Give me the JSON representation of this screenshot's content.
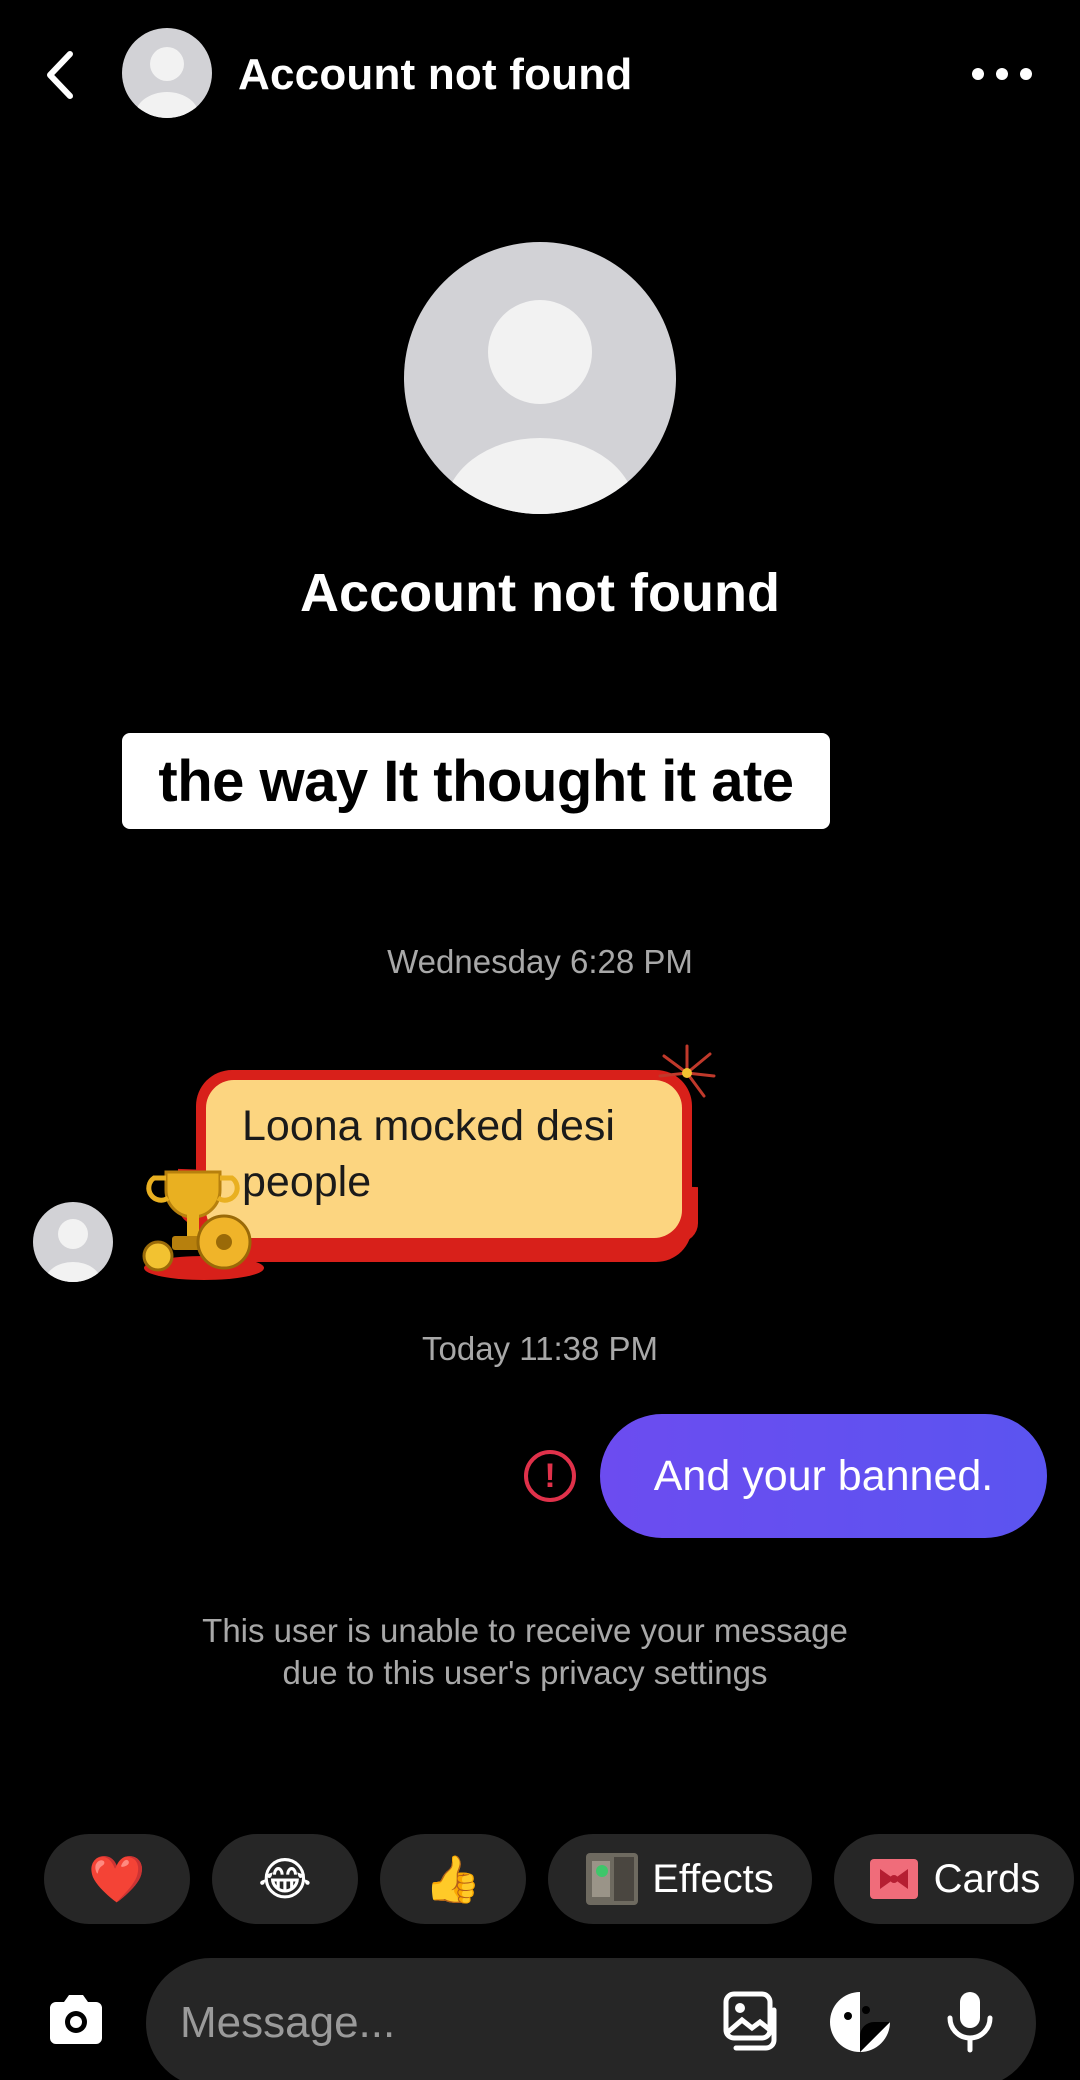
{
  "header": {
    "title": "Account not found",
    "back_icon": "chevron-left-icon",
    "more_icon": "more-horizontal-icon"
  },
  "profile": {
    "name": "Account not found"
  },
  "caption": {
    "text": "the way It thought it ate"
  },
  "thread": {
    "timestamp_1": "Wednesday 6:28 PM",
    "received_message": "Loona mocked desi people",
    "timestamp_2": "Today 11:38 PM",
    "sent_message": "And your banned.",
    "error_icon": "alert-circle-icon",
    "error_color": "#e0314a",
    "sent_bubble_color": "#5b54f0",
    "notice": "This user is unable to receive your message due to this user's privacy settings"
  },
  "quick_reactions": [
    {
      "label": "",
      "emoji": "❤️",
      "icon": "heart-icon"
    },
    {
      "label": "",
      "emoji": "😂",
      "icon": "laughing-icon"
    },
    {
      "label": "",
      "emoji": "👍",
      "icon": "thumbs-up-icon"
    },
    {
      "label": "Effects",
      "icon": "effects-thumbnail-icon"
    },
    {
      "label": "Cards",
      "icon": "cards-gift-icon"
    }
  ],
  "composer": {
    "placeholder": "Message...",
    "camera_icon": "camera-icon",
    "gallery_icon": "gallery-icon",
    "sticker_icon": "sticker-icon",
    "mic_icon": "microphone-icon"
  }
}
